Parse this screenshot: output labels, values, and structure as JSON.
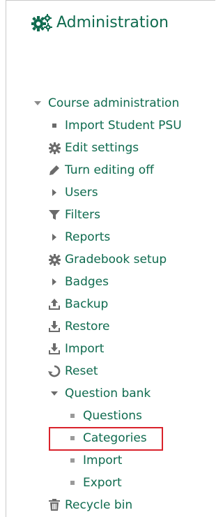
{
  "block": {
    "title": "Administration",
    "title_icon": "cogs-icon"
  },
  "colors": {
    "link": "#0f6b4f",
    "icon": "#6b6b6b",
    "highlight": "#d9222b"
  },
  "tree": {
    "course_admin": {
      "label": "Course administration",
      "icon": "triangle-down-icon",
      "expanded": true
    },
    "import_student": {
      "label": "Import Student PSU",
      "icon": "bullet-icon"
    },
    "edit_settings": {
      "label": "Edit settings",
      "icon": "gear-icon"
    },
    "turn_editing": {
      "label": "Turn editing off",
      "icon": "pencil-icon"
    },
    "users": {
      "label": "Users",
      "icon": "triangle-right-icon",
      "expanded": false
    },
    "filters": {
      "label": "Filters",
      "icon": "filter-icon"
    },
    "reports": {
      "label": "Reports",
      "icon": "triangle-right-icon",
      "expanded": false
    },
    "gradebook": {
      "label": "Gradebook setup",
      "icon": "gear-icon"
    },
    "badges": {
      "label": "Badges",
      "icon": "triangle-right-icon",
      "expanded": false
    },
    "backup": {
      "label": "Backup",
      "icon": "upload-icon"
    },
    "restore": {
      "label": "Restore",
      "icon": "download-icon"
    },
    "import": {
      "label": "Import",
      "icon": "download-icon"
    },
    "reset": {
      "label": "Reset",
      "icon": "reset-icon"
    },
    "question_bank": {
      "label": "Question bank",
      "icon": "triangle-down-icon",
      "expanded": true
    },
    "questions": {
      "label": "Questions",
      "icon": "bullet-icon"
    },
    "categories": {
      "label": "Categories",
      "icon": "bullet-icon",
      "highlighted": true
    },
    "qb_import": {
      "label": "Import",
      "icon": "bullet-icon"
    },
    "qb_export": {
      "label": "Export",
      "icon": "bullet-icon"
    },
    "recycle_bin": {
      "label": "Recycle bin",
      "icon": "trash-icon"
    }
  }
}
